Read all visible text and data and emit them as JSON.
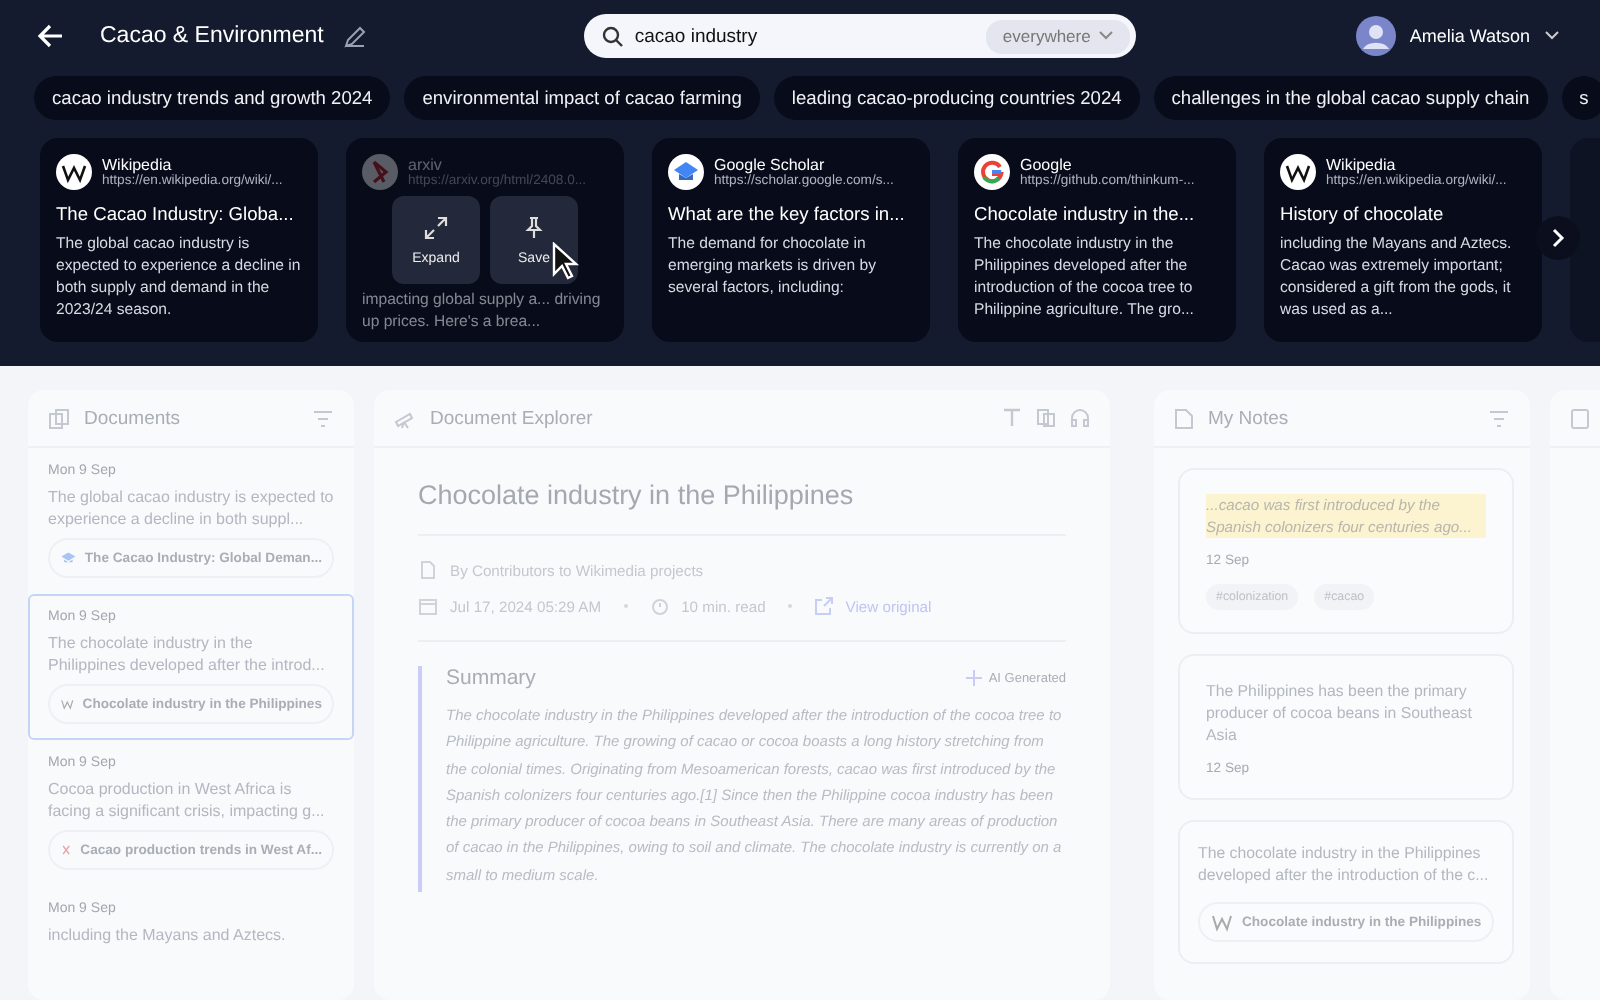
{
  "header": {
    "title": "Cacao & Environment",
    "search": {
      "value": "cacao industry",
      "scope": "everywhere"
    },
    "user": {
      "name": "Amelia Watson"
    }
  },
  "suggestions": [
    "cacao industry trends and growth 2024",
    "environmental impact of cacao farming",
    "leading cacao-producing countries 2024",
    "challenges in the global cacao supply chain",
    "s"
  ],
  "results": [
    {
      "kind": "wikipedia",
      "source": "Wikipedia",
      "url": "https://en.wikipedia.org/wiki/...",
      "title": "The Cacao Industry: Globa...",
      "snippet": "The global cacao industry is expected to experience a decline in both supply and demand in the 2023/24 season.",
      "hovered": false
    },
    {
      "kind": "arxiv",
      "source": "arxiv",
      "url": "https://arxiv.org/html/2408.0...",
      "snippet": "impacting global supply a... driving up prices. Here's a brea...",
      "hovered": true,
      "actions": [
        {
          "kind": "expand",
          "label": "Expand"
        },
        {
          "kind": "save",
          "label": "Save"
        }
      ]
    },
    {
      "kind": "scholar",
      "source": "Google Scholar",
      "url": "https://scholar.google.com/s...",
      "title": "What are the key factors in...",
      "snippet": "The demand for chocolate in emerging markets is driven by several factors, including:",
      "hovered": false
    },
    {
      "kind": "google",
      "source": "Google",
      "url": "https://github.com/thinkum-...",
      "title": "Chocolate industry in the...",
      "snippet": "The chocolate industry in the Philippines developed after the introduction of the cocoa tree to Philippine agriculture. The gro...",
      "hovered": false
    },
    {
      "kind": "wikipedia",
      "source": "Wikipedia",
      "url": "https://en.wikipedia.org/wiki/...",
      "title": "History of chocolate",
      "snippet": "including the Mayans and Aztecs. Cacao was extremely important; considered a gift from the gods, it was used as a...",
      "hovered": false
    }
  ],
  "documents": {
    "title": "Documents",
    "items": [
      {
        "date": "Mon 9 Sep",
        "snippet": "The global cacao industry is expected to experience a decline in both suppl...",
        "source": {
          "kind": "scholar",
          "title": "The Cacao Industry: Global Deman..."
        },
        "selected": false
      },
      {
        "date": "Mon 9 Sep",
        "snippet": "The chocolate industry in the Philippines developed after the introd...",
        "source": {
          "kind": "wikipedia",
          "title": "Chocolate industry in the Philippines"
        },
        "selected": true
      },
      {
        "date": "Mon 9 Sep",
        "snippet": "Cocoa production in West Africa is facing a significant crisis, impacting g...",
        "source": {
          "kind": "arxiv",
          "title": "Cacao production trends in West Af..."
        },
        "selected": false
      },
      {
        "date": "Mon 9 Sep",
        "snippet": "including the Mayans and Aztecs.",
        "selected": false
      }
    ]
  },
  "explorer": {
    "title": "Document Explorer",
    "doc_title": "Chocolate industry in the Philippines",
    "author": "By Contributors to Wikimedia projects",
    "date": "Jul 17, 2024 05:29 AM",
    "read_time": "10 min. read",
    "link": "View original",
    "summary": {
      "title": "Summary",
      "badge": "AI Generated",
      "text": "The chocolate industry in the Philippines developed after the introduction of the cocoa tree to Philippine agriculture. The growing of cacao or cocoa boasts a long history stretching from the colonial times. Originating from Mesoamerican forests, cacao was first introduced by the Spanish colonizers four centuries ago.[1] Since then the Philippine cocoa industry has been the primary producer of cocoa beans in Southeast Asia. There are many areas of production of cacao in the Philippines, owing to soil and climate. The chocolate industry is currently on a small to medium scale."
    }
  },
  "notes": {
    "title": "My Notes",
    "items": [
      {
        "kind": "quote",
        "text": "...cacao was first introduced by the Spanish colonizers four centuries ago...",
        "date": "12 Sep",
        "tags": [
          "#colonization",
          "#cacao"
        ]
      },
      {
        "kind": "text",
        "text": "The Philippines has been the primary producer of cocoa beans in Southeast Asia",
        "date": "12 Sep"
      },
      {
        "kind": "excerpt",
        "text": "The chocolate industry in the Philippines developed after the introduction of the c...",
        "source": {
          "kind": "wikipedia",
          "title": "Chocolate industry in the Philippines"
        }
      }
    ]
  }
}
